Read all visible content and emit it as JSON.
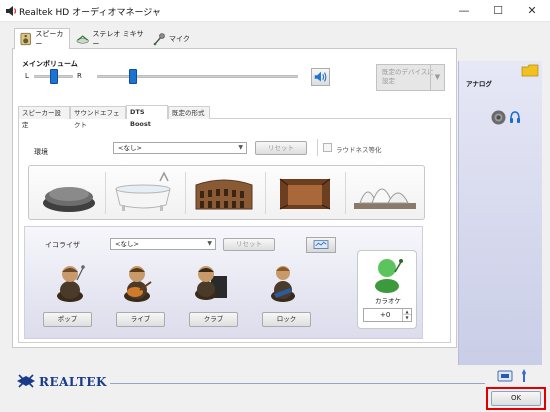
{
  "window": {
    "title": "Realtek HD オーディオマネージャ",
    "minimize": "—",
    "maximize": "☐",
    "close": "✕"
  },
  "top_tabs": [
    {
      "label": "スピーカー",
      "icon": "speaker-device-icon",
      "active": true
    },
    {
      "label": "ステレオ ミキサー",
      "icon": "stereo-mixer-icon",
      "active": false
    },
    {
      "label": "マイク",
      "icon": "microphone-icon",
      "active": false
    }
  ],
  "main_volume": {
    "label": "メインボリューム",
    "left_label": "L",
    "right_label": "R",
    "balance": 0.5,
    "level": 0.18
  },
  "device_button": {
    "line1": "既定のデバイスに",
    "line2": "設定",
    "arrow": "▼"
  },
  "sub_tabs": [
    {
      "label": "スピーカー設定",
      "active": false
    },
    {
      "label": "サウンドエフェクト",
      "active": false
    },
    {
      "label": "DTS Boost",
      "active": true
    },
    {
      "label": "既定の形式",
      "active": false
    }
  ],
  "environment": {
    "label": "環境",
    "value": "<なし>",
    "reset": "リセット",
    "loudness_label": "ラウドネス等化",
    "loudness_checked": false,
    "presets": [
      "stone-icon",
      "bathtub-icon",
      "colosseum-icon",
      "wooden-room-icon",
      "opera-house-icon"
    ]
  },
  "equalizer": {
    "label": "イコライザ",
    "value": "<なし>",
    "reset": "リセット",
    "presets": [
      {
        "label": "ポップ",
        "icon": "pop-singer-icon"
      },
      {
        "label": "ライブ",
        "icon": "live-guitarist-icon"
      },
      {
        "label": "クラブ",
        "icon": "club-pianist-icon"
      },
      {
        "label": "ロック",
        "icon": "rock-guitarist-icon"
      }
    ]
  },
  "karaoke": {
    "label": "カラオケ",
    "value": "+0",
    "icon": "karaoke-singer-icon"
  },
  "side_panel": {
    "analog_label": "アナログ"
  },
  "footer": {
    "brand": "REALTEK",
    "ok": "OK"
  },
  "colors": {
    "accent_blue": "#1f73d0",
    "side_panel": "#d6d9ef",
    "highlight_red": "#e00000"
  }
}
